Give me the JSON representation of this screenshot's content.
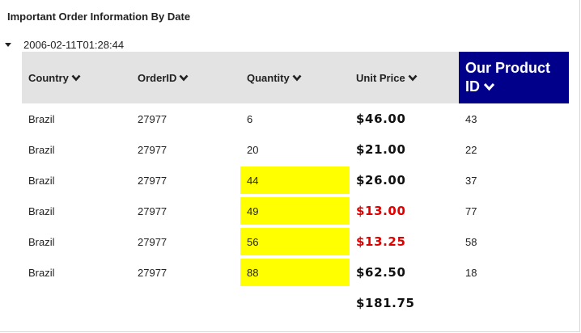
{
  "page": {
    "title": "Important Order Information By Date",
    "group_label": "2006-02-11T01:28:44"
  },
  "columns": [
    {
      "label": "Country",
      "icon": "chevron-down-icon"
    },
    {
      "label": "OrderID",
      "icon": "chevron-down-icon"
    },
    {
      "label": "Quantity",
      "icon": "chevron-down-icon"
    },
    {
      "label": "Unit Price",
      "icon": "chevron-down-icon"
    },
    {
      "label_line1": "Our Product",
      "label_line2": "ID",
      "icon": "chevron-down-icon"
    }
  ],
  "rows": [
    {
      "country": "Brazil",
      "order_id": "27977",
      "quantity": "6",
      "unit_price": "$46.00",
      "product_id": "43",
      "qty_highlight": false,
      "price_red": false
    },
    {
      "country": "Brazil",
      "order_id": "27977",
      "quantity": "20",
      "unit_price": "$21.00",
      "product_id": "22",
      "qty_highlight": false,
      "price_red": false
    },
    {
      "country": "Brazil",
      "order_id": "27977",
      "quantity": "44",
      "unit_price": "$26.00",
      "product_id": "37",
      "qty_highlight": true,
      "price_red": false
    },
    {
      "country": "Brazil",
      "order_id": "27977",
      "quantity": "49",
      "unit_price": "$13.00",
      "product_id": "77",
      "qty_highlight": true,
      "price_red": true
    },
    {
      "country": "Brazil",
      "order_id": "27977",
      "quantity": "56",
      "unit_price": "$13.25",
      "product_id": "58",
      "qty_highlight": true,
      "price_red": true
    },
    {
      "country": "Brazil",
      "order_id": "27977",
      "quantity": "88",
      "unit_price": "$62.50",
      "product_id": "18",
      "qty_highlight": true,
      "price_red": false
    }
  ],
  "footer": {
    "unit_price_total": "$181.75"
  },
  "colors": {
    "header_bg": "#e3e3e3",
    "special_header_bg": "#00008b",
    "highlight": "#ffff00",
    "negative_price": "#e00000"
  }
}
